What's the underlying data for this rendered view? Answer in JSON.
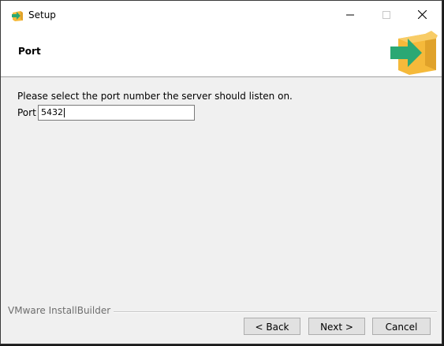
{
  "window": {
    "title": "Setup"
  },
  "header": {
    "title": "Port",
    "icon": "installer-box-arrow-icon"
  },
  "main": {
    "prompt": "Please select the port number the server should listen on.",
    "port_label": "Port",
    "port_value": "5432"
  },
  "footer": {
    "brand": "VMware InstallBuilder",
    "back_label": "< Back",
    "next_label": "Next >",
    "cancel_label": "Cancel"
  },
  "colors": {
    "header_bg": "#ffffff",
    "body_bg": "#f0f0f0",
    "logo_box": "#f5b93a",
    "logo_arrow": "#2aa874"
  }
}
